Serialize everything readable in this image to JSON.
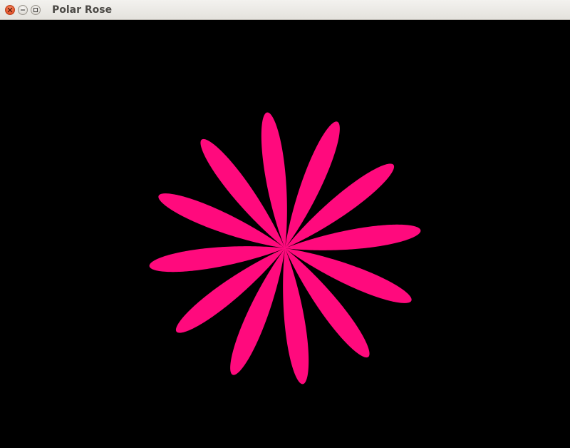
{
  "window": {
    "title": "Polar Rose",
    "controls": {
      "close_icon": "close-icon",
      "minimize_icon": "minimize-icon",
      "maximize_icon": "maximize-icon"
    }
  },
  "canvas": {
    "background_color": "#000000",
    "rose": {
      "petal_count": 12,
      "color": "#ff0a7d"
    }
  }
}
